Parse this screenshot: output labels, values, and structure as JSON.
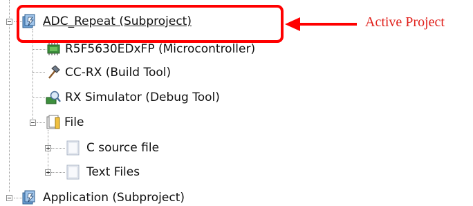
{
  "tree": {
    "nodes": [
      {
        "name": "adc-repeat-subproject",
        "label": "ADC_Repeat (Subproject)",
        "icon": "subproject-icon",
        "expander": "minus"
      },
      {
        "name": "microcontroller",
        "label": "R5F5630EDxFP (Microcontroller)",
        "icon": "microcontroller-chip-icon"
      },
      {
        "name": "build-tool",
        "label": "CC-RX (Build Tool)",
        "icon": "hammer-icon"
      },
      {
        "name": "debug-tool",
        "label": "RX Simulator (Debug Tool)",
        "icon": "simulator-magnifier-icon"
      },
      {
        "name": "file-folder",
        "label": "File",
        "icon": "file-folder-icon",
        "expander": "minus"
      },
      {
        "name": "c-source-file-folder",
        "label": "C source file",
        "icon": "category-folder-icon",
        "expander": "plus"
      },
      {
        "name": "text-files-folder",
        "label": "Text Files",
        "icon": "category-folder-icon",
        "expander": "plus"
      },
      {
        "name": "application-subproject",
        "label": "Application (Subproject)",
        "icon": "subproject-icon",
        "expander": "minus"
      }
    ]
  },
  "annotation": {
    "text": "Active Project",
    "color": "#e0201b"
  }
}
